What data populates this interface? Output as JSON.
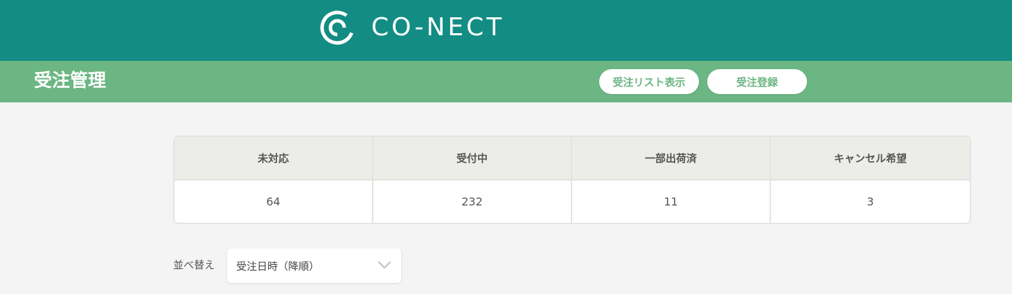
{
  "header": {
    "logo_text": "CO-NECT",
    "brand_color": "#138d84"
  },
  "subheader": {
    "title": "受注管理",
    "accent_color": "#6cb683",
    "buttons": {
      "order_list": "受注リスト表示",
      "order_register": "受注登録"
    }
  },
  "status_summary": {
    "columns": [
      {
        "label": "未対応",
        "count": "64"
      },
      {
        "label": "受付中",
        "count": "232"
      },
      {
        "label": "一部出荷済",
        "count": "11"
      },
      {
        "label": "キャンセル希望",
        "count": "3"
      }
    ]
  },
  "sort": {
    "label": "並べ替え",
    "selected": "受注日時（降順）",
    "icon": "chevron-down-icon"
  }
}
